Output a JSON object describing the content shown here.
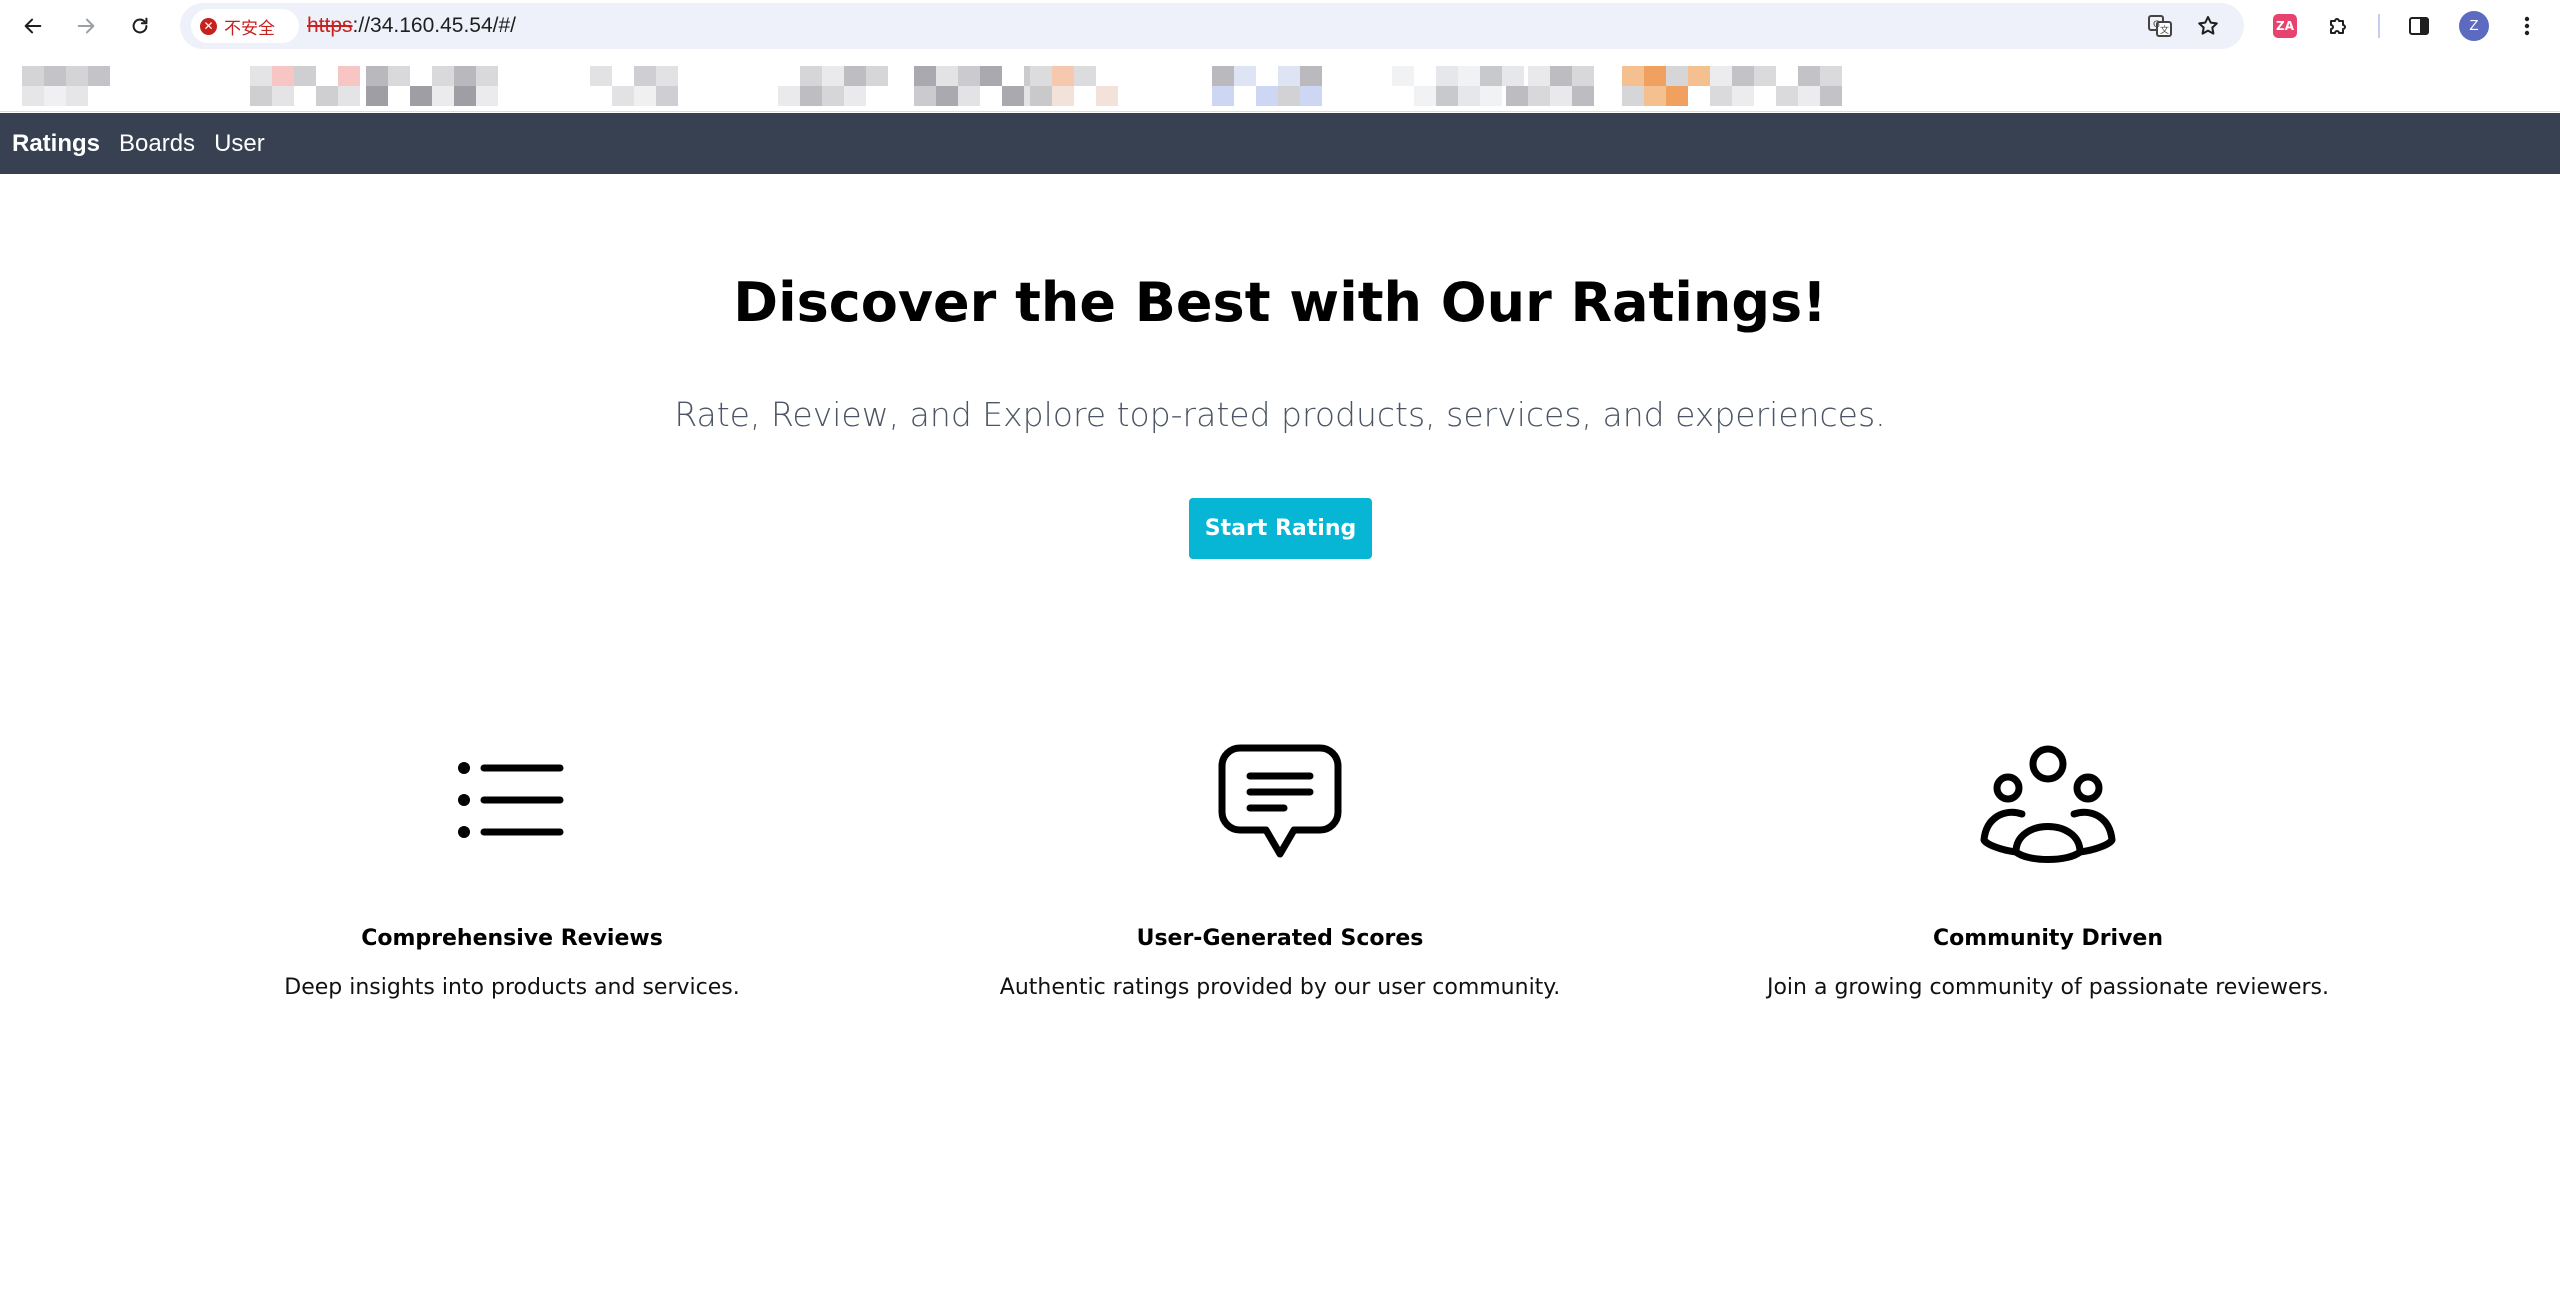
{
  "browser": {
    "security_label": "不安全",
    "url_scheme": "https",
    "url_rest": "://34.160.45.54/#/",
    "profile_initial": "Z",
    "extension_label": "ZA"
  },
  "nav": {
    "items": [
      {
        "label": "Ratings",
        "active": true
      },
      {
        "label": "Boards",
        "active": false
      },
      {
        "label": "User",
        "active": false
      }
    ]
  },
  "hero": {
    "title": "Discover the Best with Our Ratings!",
    "subtitle": "Rate, Review, and Explore top-rated products, services, and experiences.",
    "cta_label": "Start Rating"
  },
  "features": [
    {
      "icon": "list-icon",
      "title": "Comprehensive Reviews",
      "description": "Deep insights into products and services."
    },
    {
      "icon": "chat-bubble-icon",
      "title": "User-Generated Scores",
      "description": "Authentic ratings provided by our user community."
    },
    {
      "icon": "users-group-icon",
      "title": "Community Driven",
      "description": "Join a growing community of passionate reviewers."
    }
  ],
  "colors": {
    "navbar_bg": "#374151",
    "cta_bg": "#06b6d4",
    "subtitle_text": "#4b5563"
  }
}
